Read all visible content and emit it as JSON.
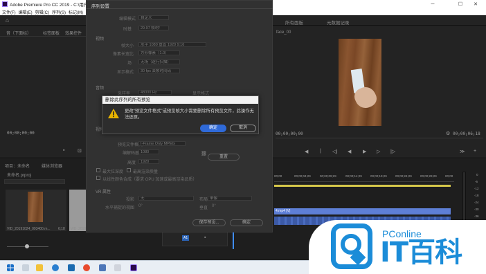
{
  "window": {
    "title": "Adobe Premiere Pro CC 2019 - C:\\用户\\42\\文",
    "controls": {
      "minimize": "─",
      "maximize": "☐",
      "close": "✕"
    }
  },
  "menu": [
    "文件(F)",
    "编辑(E)",
    "剪辑(C)",
    "序列(S)",
    "标记(M)",
    "图形"
  ],
  "workspace_tabs": {
    "left_1": "音（下面标）",
    "left_2": "标签面板",
    "left_3": "效果控件",
    "right_1": "所有面板",
    "right_2": "元数据记录",
    "right_small": "face_00"
  },
  "source_monitor": {
    "timecode_left": "00;00;00;00",
    "timecode_right": "00;00;00;00"
  },
  "program_monitor": {
    "timecode_left": "00;00;00;00",
    "timecode_right": "00;00;06;18",
    "playback": [
      "◀",
      "|",
      "◁|",
      "◀",
      "▶",
      "▷",
      "|▷",
      "≫",
      "+"
    ]
  },
  "project_panel": {
    "tabs": [
      "项目：未命名",
      "媒体浏览器"
    ],
    "project_file": "未命名.prproj",
    "thumb_1_label": "VID_20191024_093400.m...",
    "thumb_1_duration": "6;18",
    "thumb_2_label": "VID_2019"
  },
  "timeline": {
    "ruler": [
      "00;00",
      "00;00;04;29",
      "00;00;09;29",
      "00;00;14;29",
      "00;00;19;29",
      "00;00;24;29",
      "00;00;29;29",
      "00;00;34;28",
      "00;00"
    ],
    "clip_label": "4.mp4 [V]",
    "meter": [
      "0",
      "-6",
      "-12",
      "-18",
      "-24",
      "-30",
      "-36",
      "-42",
      "-48"
    ],
    "zoom_label": "A1"
  },
  "sequence_dialog": {
    "title": "序列设置",
    "rows": [
      {
        "label": "编辑模式",
        "value": "自定义"
      },
      {
        "label": "时基",
        "value": "29.97 帧/秒"
      },
      {
        "label": "帧大小",
        "value": "水平 1080   垂直 1920   9:16"
      },
      {
        "label": "像素长宽比",
        "value": "方形像素（1.0）"
      },
      {
        "label": "场",
        "value": "无场（逐行扫描）"
      },
      {
        "label": "显示格式",
        "value": "30 fps 丢帧时间码"
      }
    ],
    "section_audio": "音频",
    "audio_rows": [
      {
        "label": "采样率",
        "value": "48000 Hz"
      },
      {
        "label": "显示格式",
        "value": "音频采样"
      }
    ],
    "section_video": "视频预览",
    "preview_rows": [
      {
        "label": "预览文件格式",
        "value": "I-Frame Only MPEG"
      },
      {
        "label": "编解码器",
        "value": "MPEG I-Frame"
      },
      {
        "label": "宽度",
        "value": "1080"
      },
      {
        "label": "高度",
        "value": "1920"
      }
    ],
    "reset_button": "重置",
    "checkboxes": [
      "最大位深度",
      "最高渲染质量",
      "以线性颜色合成（要求 GPU 加速或最高渲染品质）"
    ],
    "section_vr": "VR 属性",
    "vr_rows": [
      {
        "label": "投影",
        "value": "无"
      },
      {
        "label": "布局",
        "value": "单像"
      },
      {
        "label": "水平捕捉的视图",
        "value": "0°"
      },
      {
        "label": "垂直",
        "value": "0°"
      }
    ],
    "save_preset_button": "保存预设...",
    "ok_button": "确定",
    "cancel_button": "取消"
  },
  "alert": {
    "title": "删除此序列的所有预览",
    "message": "更改“预览文件格式”或预览帧大小需要删除所有预览文件，此操作无法还原。",
    "ok": "确定",
    "cancel": "取消"
  },
  "watermark": {
    "brand": "PConline",
    "cn": "IT百科"
  },
  "colors": {
    "accent_blue": "#2f6ad9",
    "watermark_blue": "#1b8cd8",
    "timeline_yellow": "#d6c84a",
    "clip_blue": "#5e7fd6"
  }
}
